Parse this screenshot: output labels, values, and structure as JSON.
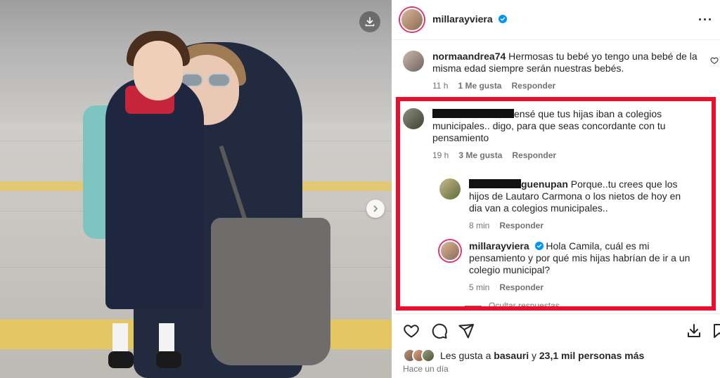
{
  "post": {
    "author": "millarayviera",
    "verified": true
  },
  "comments": [
    {
      "username": "normaandrea74",
      "text": "Hermosas tu bebé yo tengo una bebé de la misma edad siempre serán nuestras bebés.",
      "time": "11 h",
      "likes": "1 Me gusta",
      "reply_label": "Responder"
    },
    {
      "username": "",
      "text_fragment": "ensé que tus hijas iban a colegios municipales.. digo, para que seas concordante con tu pensamiento",
      "time": "19 h",
      "likes": "3 Me gusta",
      "reply_label": "Responder"
    }
  ],
  "replies": [
    {
      "username_fragment": "guenupan",
      "text": "Porque..tu crees que los hijos de Lautaro Carmona o los nietos de hoy en dia van a colegios municipales..",
      "time": "8 min",
      "reply_label": "Responder"
    },
    {
      "username": "millarayviera",
      "verified": true,
      "text": "Hola Camila, cuál es mi pensamiento y por qué mis hijas habrían de ir a un colegio municipal?",
      "time": "5 min",
      "reply_label": "Responder"
    }
  ],
  "hide_replies_label": "Ocultar respuestas",
  "likes_summary": {
    "prefix": "Les gusta a",
    "user": "basauri",
    "middle": "y",
    "others": "23,1 mil personas más"
  },
  "date_label": "Hace un día",
  "icons": [
    "download-icon",
    "chevron-right-icon",
    "more-icon",
    "heart-icon",
    "comment-icon",
    "share-icon",
    "save-icon",
    "verified-icon"
  ],
  "colors": {
    "highlight": "#e8112d",
    "verified": "#0095f6",
    "meta_text": "#737373"
  }
}
